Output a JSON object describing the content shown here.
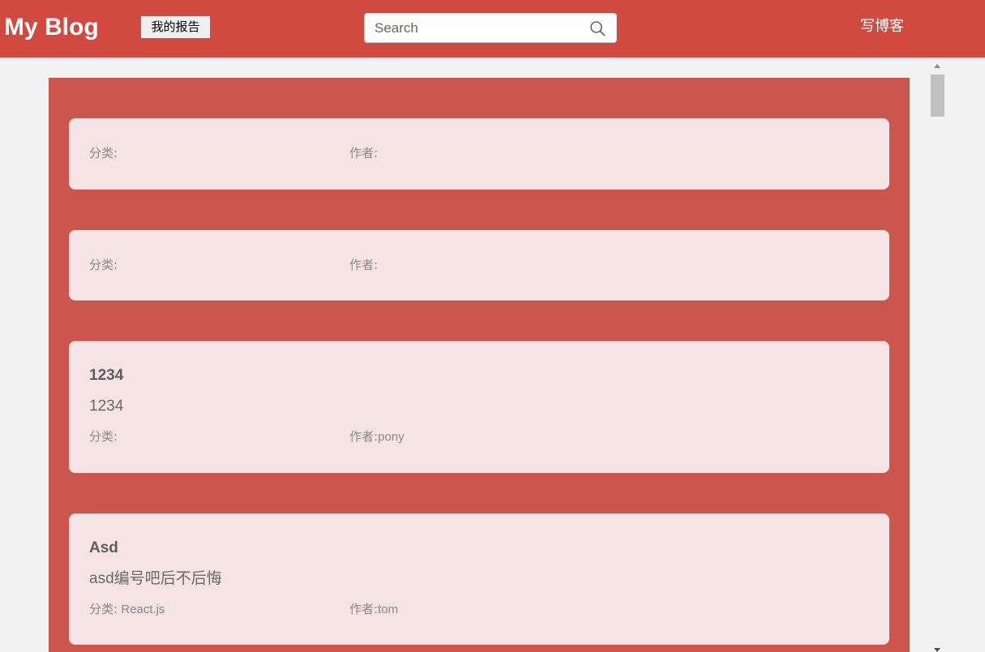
{
  "navbar": {
    "brand": "My Blog",
    "report_button": "我的报告",
    "search_placeholder": "Search",
    "write_link": "写博客",
    "color": "#d24a3f"
  },
  "posts": [
    {
      "title": "",
      "summary": "",
      "category_label": "分类:",
      "category": "",
      "author_label": "作者:",
      "author": ""
    },
    {
      "title": "",
      "summary": "",
      "category_label": "分类:",
      "category": "",
      "author_label": "作者:",
      "author": ""
    },
    {
      "title": "1234",
      "summary": "1234",
      "category_label": "分类:",
      "category": "",
      "author_label": "作者:",
      "author": "pony"
    },
    {
      "title": "Asd",
      "summary": "asd编号吧后不后悔",
      "category_label": "分类:",
      "category": "React.js",
      "author_label": "作者:",
      "author": "tom"
    }
  ],
  "icons": {
    "search": "search-icon",
    "scroll_up": "scroll-up-arrow-icon",
    "scroll_down": "scroll-down-arrow-icon"
  },
  "colors": {
    "panel": "#cb564d",
    "card": "#f6e3e3"
  }
}
